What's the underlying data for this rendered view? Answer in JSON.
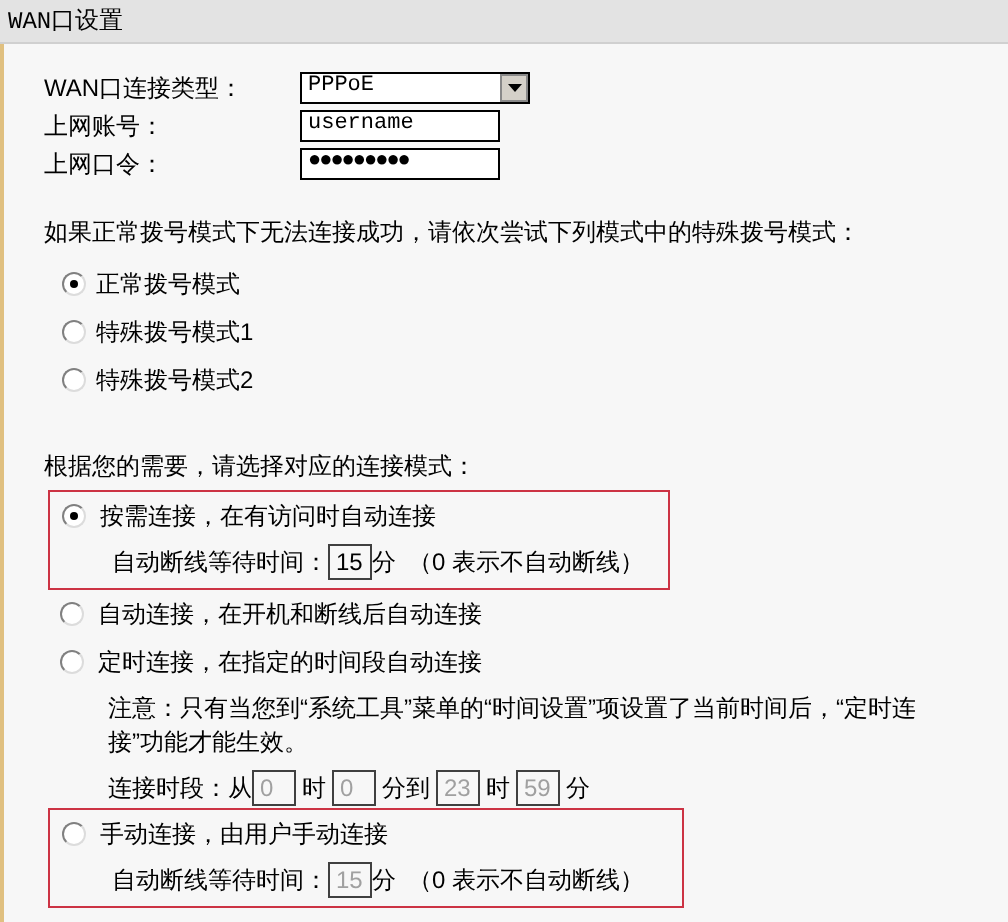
{
  "section_title": "WAN口设置",
  "fields": [
    {
      "kind": "select",
      "label": "WAN口连接类型：",
      "value": "PPPoE"
    },
    {
      "kind": "text",
      "label": "上网账号：",
      "value": "username"
    },
    {
      "kind": "password",
      "label": "上网口令：",
      "value": "●●●●●●●●●"
    }
  ],
  "dial_modes": {
    "prompt": "如果正常拨号模式下无法连接成功，请依次尝试下列模式中的特殊拨号模式：",
    "options": [
      {
        "label": "正常拨号模式",
        "selected": true
      },
      {
        "label": "特殊拨号模式1",
        "selected": false
      },
      {
        "label": "特殊拨号模式2",
        "selected": false
      }
    ]
  },
  "connection_modes": {
    "prompt": "根据您的需要，请选择对应的连接模式：",
    "options": [
      {
        "kind": "idle",
        "label": "按需连接，在有访问时自动连接",
        "selected": true,
        "highlighted": true,
        "wait_label": "自动断线等待时间：",
        "wait_value": "15",
        "wait_unit": "分",
        "wait_note": "（0 表示不自动断线）",
        "disabled": false
      },
      {
        "kind": "plain",
        "label": "自动连接，在开机和断线后自动连接",
        "selected": false,
        "highlighted": false
      },
      {
        "kind": "schedule",
        "label": "定时连接，在指定的时间段自动连接",
        "selected": false,
        "highlighted": false,
        "note": "注意：只有当您到“系统工具”菜单的“时间设置”项设置了当前时间后，“定时连接”功能才能生效。",
        "slot_label": "连接时段：从",
        "disabled": true,
        "times": [
          {
            "value": "0",
            "unit": "时"
          },
          {
            "value": "0",
            "unit": "分到"
          },
          {
            "value": "23",
            "unit": "时"
          },
          {
            "value": "59",
            "unit": "分"
          }
        ]
      },
      {
        "kind": "idle",
        "label": "手动连接，由用户手动连接",
        "selected": false,
        "highlighted": true,
        "wait_label": "自动断线等待时间：",
        "wait_value": "15",
        "wait_unit": "分",
        "wait_note": "（0 表示不自动断线）",
        "disabled": true
      }
    ]
  }
}
